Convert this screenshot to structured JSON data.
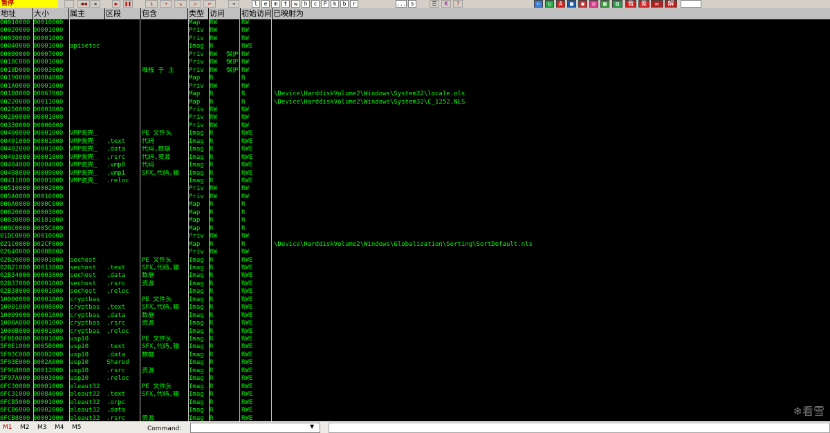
{
  "status_text": "暂停",
  "toolbar": {
    "letter_buttons": [
      "l",
      "e",
      "m",
      "t",
      "w",
      "h",
      "c",
      "P",
      "k",
      "b",
      "r",
      "...",
      "s"
    ]
  },
  "headers": {
    "addr": "地址",
    "size": "大小",
    "owner": "属主",
    "section": "区段",
    "contains": "包含",
    "type": "类型",
    "access": "访问",
    "init": "初始访问",
    "mapped": "已映射为"
  },
  "rows": [
    [
      "00010000",
      "00010000",
      "",
      "",
      "",
      "Map",
      "RW",
      "",
      "RW",
      ""
    ],
    [
      "00020000",
      "00001000",
      "",
      "",
      "",
      "Priv",
      "RW",
      "",
      "RW",
      ""
    ],
    [
      "00030000",
      "00001000",
      "",
      "",
      "",
      "Priv",
      "RW",
      "",
      "RW",
      ""
    ],
    [
      "00040000",
      "00001000",
      "apisetsc",
      "",
      "",
      "Imag",
      "R",
      "",
      "RWE",
      ""
    ],
    [
      "00080000",
      "00007000",
      "",
      "",
      "",
      "Priv",
      "RW",
      "保护",
      "RW",
      ""
    ],
    [
      "0018C000",
      "00001000",
      "",
      "",
      "",
      "Priv",
      "RW",
      "保护",
      "RW",
      ""
    ],
    [
      "0018D000",
      "00003000",
      "",
      "",
      "堆栈 于  主",
      "Priv",
      "RW",
      "保护",
      "RW",
      ""
    ],
    [
      "00190000",
      "00004000",
      "",
      "",
      "",
      "Map",
      "R",
      "",
      "R",
      ""
    ],
    [
      "001A0000",
      "00001000",
      "",
      "",
      "",
      "Priv",
      "RW",
      "",
      "RW",
      ""
    ],
    [
      "001B0000",
      "00067000",
      "",
      "",
      "",
      "Map",
      "R",
      "",
      "R",
      "\\Device\\HarddiskVolume2\\Windows\\System32\\locale.nls"
    ],
    [
      "00220000",
      "00011000",
      "",
      "",
      "",
      "Map",
      "R",
      "",
      "R",
      "\\Device\\HarddiskVolume2\\Windows\\System32\\C_1252.NLS"
    ],
    [
      "00250000",
      "00003000",
      "",
      "",
      "",
      "Priv",
      "RW",
      "",
      "RW",
      ""
    ],
    [
      "00280000",
      "00001000",
      "",
      "",
      "",
      "Priv",
      "RW",
      "",
      "RW",
      ""
    ],
    [
      "00330000",
      "00006000",
      "",
      "",
      "",
      "Priv",
      "RW",
      "",
      "RW",
      ""
    ],
    [
      "00400000",
      "00001000",
      "VMP脱壳_",
      "",
      "PE 文件头",
      "Imag",
      "R",
      "",
      "RWE",
      ""
    ],
    [
      "00401000",
      "00001000",
      "VMP脱壳_",
      ".text",
      "代码",
      "Imag",
      "R",
      "",
      "RWE",
      ""
    ],
    [
      "00402000",
      "00001000",
      "VMP脱壳_",
      ".data",
      "代码,数据",
      "Imag",
      "R",
      "",
      "RWE",
      ""
    ],
    [
      "00403000",
      "00001000",
      "VMP脱壳_",
      ".rsrc",
      "代码,资源",
      "Imag",
      "R",
      "",
      "RWE",
      ""
    ],
    [
      "00404000",
      "00004000",
      "VMP脱壳_",
      ".vmp0",
      "代码",
      "Imag",
      "R",
      "",
      "RWE",
      ""
    ],
    [
      "00408000",
      "00009000",
      "VMP脱壳_",
      ".vmp1",
      "SFX,代码,输",
      "Imag",
      "R",
      "",
      "RWE",
      ""
    ],
    [
      "00411000",
      "00001000",
      "VMP脱壳_",
      ".reloc",
      "",
      "Imag",
      "R",
      "",
      "RWE",
      ""
    ],
    [
      "00510000",
      "00002000",
      "",
      "",
      "",
      "Priv",
      "RW",
      "",
      "RW",
      ""
    ],
    [
      "005A0000",
      "00016000",
      "",
      "",
      "",
      "Priv",
      "RW",
      "",
      "RW",
      ""
    ],
    [
      "006A0000",
      "0000C000",
      "",
      "",
      "",
      "Map",
      "R",
      "",
      "R",
      ""
    ],
    [
      "00820000",
      "00003000",
      "",
      "",
      "",
      "Map",
      "R",
      "",
      "R",
      ""
    ],
    [
      "00830000",
      "00181000",
      "",
      "",
      "",
      "Map",
      "R",
      "",
      "R",
      ""
    ],
    [
      "009C0000",
      "0005C000",
      "",
      "",
      "",
      "Map",
      "R",
      "",
      "R",
      ""
    ],
    [
      "01DC0000",
      "00010000",
      "",
      "",
      "",
      "Priv",
      "RW",
      "",
      "RW",
      ""
    ],
    [
      "021C0000",
      "002CF000",
      "",
      "",
      "",
      "Map",
      "R",
      "",
      "R",
      "\\Device\\HarddiskVolume2\\Windows\\Globalization\\Sorting\\SortDefault.nls"
    ],
    [
      "02640000",
      "0000B000",
      "",
      "",
      "",
      "Priv",
      "RW",
      "",
      "RW",
      ""
    ],
    [
      "02B20000",
      "00001000",
      "sechost",
      "",
      "PE 文件头",
      "Imag",
      "R",
      "",
      "RWE",
      ""
    ],
    [
      "02B21000",
      "00013000",
      "sechost",
      ".text",
      "SFX,代码,输",
      "Imag",
      "R",
      "",
      "RWE",
      ""
    ],
    [
      "02B34000",
      "00003000",
      "sechost",
      ".data",
      "数据",
      "Imag",
      "R",
      "",
      "RWE",
      ""
    ],
    [
      "02B37000",
      "00001000",
      "sechost",
      ".rsrc",
      "资源",
      "Imag",
      "R",
      "",
      "RWE",
      ""
    ],
    [
      "02B38000",
      "00001000",
      "sechost",
      ".reloc",
      "",
      "Imag",
      "R",
      "",
      "RWE",
      ""
    ],
    [
      "10000000",
      "00001000",
      "cryptbas",
      "",
      "PE 文件头",
      "Imag",
      "R",
      "",
      "RWE",
      ""
    ],
    [
      "10001000",
      "00008000",
      "cryptbas",
      ".text",
      "SFX,代码,输",
      "Imag",
      "R",
      "",
      "RWE",
      ""
    ],
    [
      "10009000",
      "00001000",
      "cryptbas",
      ".data",
      "数据",
      "Imag",
      "R",
      "",
      "RWE",
      ""
    ],
    [
      "1000A000",
      "00001000",
      "cryptbas",
      ".rsrc",
      "资源",
      "Imag",
      "R",
      "",
      "RWE",
      ""
    ],
    [
      "1000B000",
      "00001000",
      "cryptbas",
      ".reloc",
      "",
      "Imag",
      "R",
      "",
      "RWE",
      ""
    ],
    [
      "5F8E0000",
      "00001000",
      "usp10",
      "",
      "PE 文件头",
      "Imag",
      "R",
      "",
      "RWE",
      ""
    ],
    [
      "5F8E1000",
      "0005B000",
      "usp10",
      ".text",
      "SFX,代码,输",
      "Imag",
      "R",
      "",
      "RWE",
      ""
    ],
    [
      "5F93C000",
      "00002000",
      "usp10",
      ".data",
      "数据",
      "Imag",
      "R",
      "",
      "RWE",
      ""
    ],
    [
      "5F93E000",
      "0002A000",
      "usp10",
      "Shared",
      "",
      "Imag",
      "R",
      "",
      "RWE",
      ""
    ],
    [
      "5F968000",
      "00012000",
      "usp10",
      ".rsrc",
      "资源",
      "Imag",
      "R",
      "",
      "RWE",
      ""
    ],
    [
      "5F97A000",
      "00003000",
      "usp10",
      ".reloc",
      "",
      "Imag",
      "R",
      "",
      "RWE",
      ""
    ],
    [
      "6FC30000",
      "00001000",
      "oleaut32",
      "",
      "PE 文件头",
      "Imag",
      "R",
      "",
      "RWE",
      ""
    ],
    [
      "6FC31000",
      "00084000",
      "oleaut32",
      ".text",
      "SFX,代码,输",
      "Imag",
      "R",
      "",
      "RWE",
      ""
    ],
    [
      "6FCB5000",
      "00001000",
      "oleaut32",
      ".orpc",
      "",
      "Imag",
      "R",
      "",
      "RWE",
      ""
    ],
    [
      "6FCB6000",
      "00002000",
      "oleaut32",
      ".data",
      "",
      "Imag",
      "R",
      "",
      "RWE",
      ""
    ],
    [
      "6FCB8000",
      "00001000",
      "oleaut32",
      ".rsrc",
      "资源",
      "Imag",
      "R",
      "",
      "RWE",
      ""
    ]
  ],
  "bottom": {
    "marks": [
      "M1",
      "M2",
      "M3",
      "M4",
      "M5"
    ],
    "command_label": "Command:"
  },
  "watermark": "看雪",
  "colors": {
    "text": "#00ff00",
    "bg": "#000000",
    "status_bg": "#ffff00",
    "status_text": "#c00000",
    "header_bg": "#c0c0c0"
  }
}
